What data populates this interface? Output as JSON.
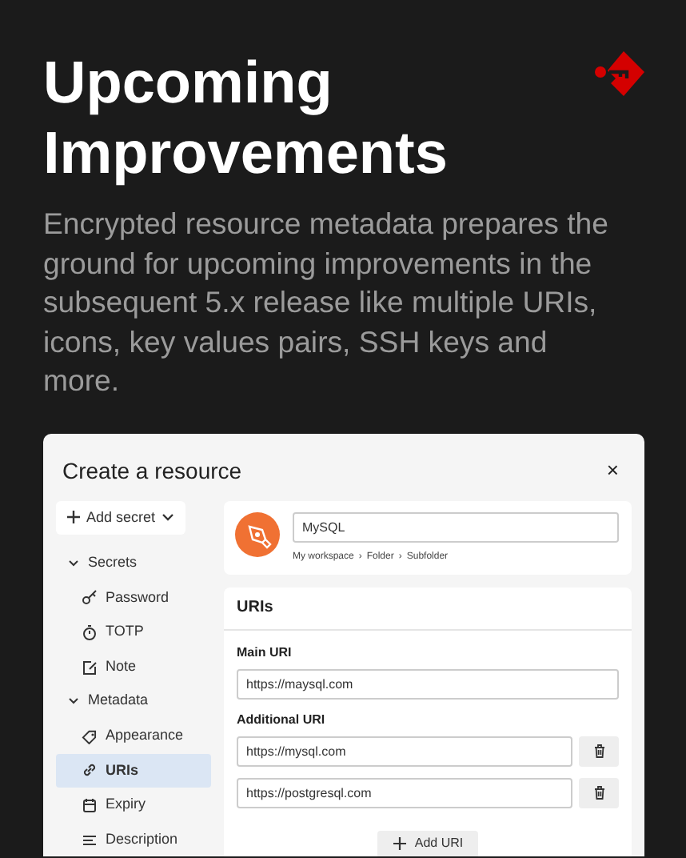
{
  "title": "Upcoming Improvements",
  "description": "Encrypted resource metadata prepares the ground for upcoming improvements in the subsequent 5.x release like multiple URIs, icons, key values pairs, SSH keys and more.",
  "dialog": {
    "title": "Create a resource",
    "close": "×",
    "add_secret": "Add secret",
    "nav": [
      {
        "label": "Secrets",
        "expanded": true,
        "children": [
          {
            "label": "Password",
            "selected": false
          },
          {
            "label": "TOTP",
            "selected": false
          },
          {
            "label": "Note",
            "selected": false
          }
        ]
      },
      {
        "label": "Metadata",
        "expanded": true,
        "children": [
          {
            "label": "Appearance",
            "selected": false
          },
          {
            "label": "URIs",
            "selected": true
          },
          {
            "label": "Expiry",
            "selected": false
          },
          {
            "label": "Description",
            "selected": false
          }
        ]
      }
    ],
    "resource": {
      "name": "MySQL",
      "breadcrumb": [
        "My workspace",
        "Folder",
        "Subfolder"
      ],
      "separator": "›"
    },
    "uris": {
      "heading": "URIs",
      "main_label": "Main URI",
      "main_value": "https://maysql.com",
      "additional_label": "Additional URI",
      "additional": [
        "https://mysql.com",
        "https://postgresql.com"
      ],
      "add_button": "Add URI"
    }
  }
}
